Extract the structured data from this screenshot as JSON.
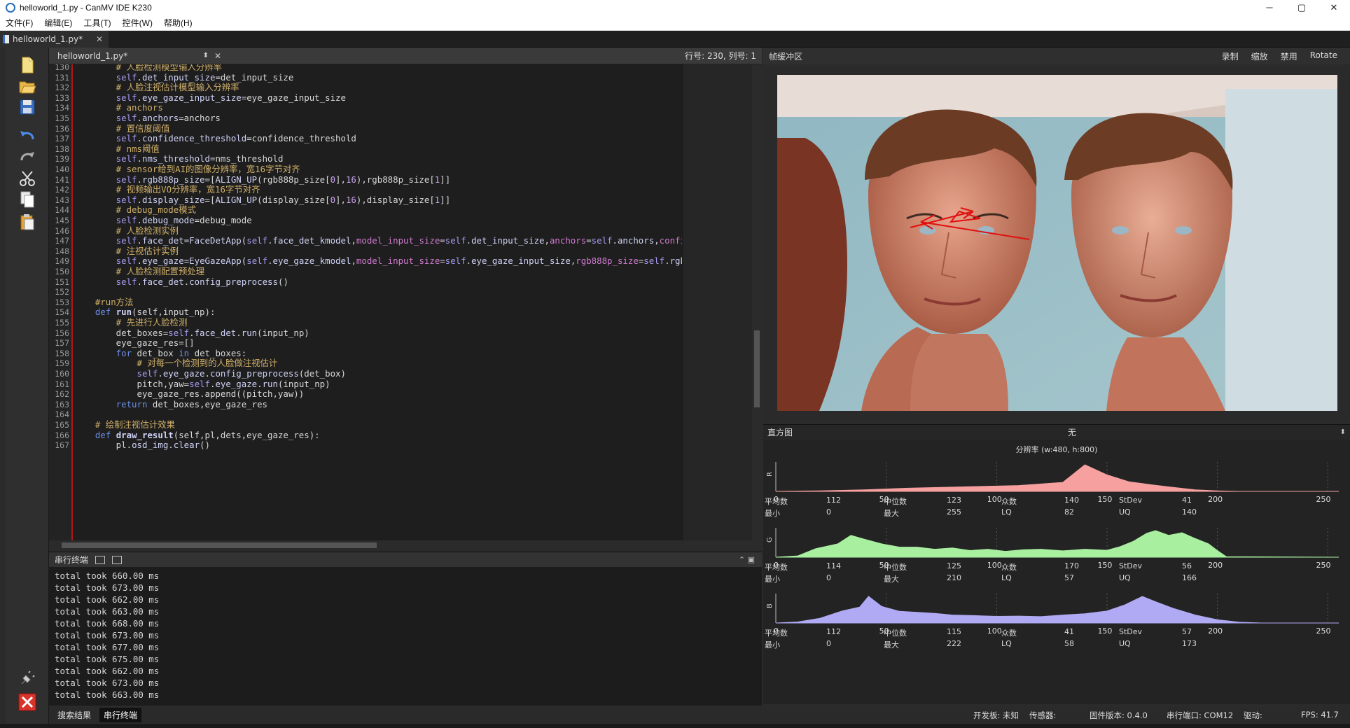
{
  "window": {
    "title": "helloworld_1.py - CanMV IDE K230",
    "minimize": "─",
    "maximize": "▢",
    "close": "✕"
  },
  "menu": [
    "文件(F)",
    "编辑(E)",
    "工具(T)",
    "控件(W)",
    "帮助(H)"
  ],
  "tab": {
    "label": "helloworld_1.py*"
  },
  "editor": {
    "file": "helloworld_1.py*",
    "position": "行号: 230, 列号: 1",
    "lines": [
      {
        "n": "130",
        "t": [
          [
            "c",
            "        # 人脸检测模型输入分辨率"
          ]
        ]
      },
      {
        "n": "131",
        "t": [
          [
            "s",
            "        self"
          ],
          [
            "w",
            "."
          ],
          [
            "a",
            "det_input_size"
          ],
          [
            "w",
            "=det_input_size"
          ]
        ]
      },
      {
        "n": "132",
        "t": [
          [
            "c",
            "        # 人脸注视估计模型输入分辨率"
          ]
        ]
      },
      {
        "n": "133",
        "t": [
          [
            "s",
            "        self"
          ],
          [
            "w",
            "."
          ],
          [
            "a",
            "eye_gaze_input_size"
          ],
          [
            "w",
            "=eye_gaze_input_size"
          ]
        ]
      },
      {
        "n": "134",
        "t": [
          [
            "c",
            "        # anchors"
          ]
        ]
      },
      {
        "n": "135",
        "t": [
          [
            "s",
            "        self"
          ],
          [
            "w",
            "."
          ],
          [
            "a",
            "anchors"
          ],
          [
            "w",
            "=anchors"
          ]
        ]
      },
      {
        "n": "136",
        "t": [
          [
            "c",
            "        # 置信度阈值"
          ]
        ]
      },
      {
        "n": "137",
        "t": [
          [
            "s",
            "        self"
          ],
          [
            "w",
            "."
          ],
          [
            "a",
            "confidence_threshold"
          ],
          [
            "w",
            "=confidence_threshold"
          ]
        ]
      },
      {
        "n": "138",
        "t": [
          [
            "c",
            "        # nms阈值"
          ]
        ]
      },
      {
        "n": "139",
        "t": [
          [
            "s",
            "        self"
          ],
          [
            "w",
            "."
          ],
          [
            "a",
            "nms_threshold"
          ],
          [
            "w",
            "=nms_threshold"
          ]
        ]
      },
      {
        "n": "140",
        "t": [
          [
            "c",
            "        # sensor给到AI的图像分辨率，宽16字节对齐"
          ]
        ]
      },
      {
        "n": "141",
        "t": [
          [
            "s",
            "        self"
          ],
          [
            "w",
            "."
          ],
          [
            "a",
            "rgb888p_size"
          ],
          [
            "w",
            "=["
          ],
          [
            "a",
            "ALIGN_UP"
          ],
          [
            "w",
            "(rgb888p_size["
          ],
          [
            "n",
            "0"
          ],
          [
            "w",
            "],"
          ],
          [
            "n",
            "16"
          ],
          [
            "w",
            "),rgb888p_size["
          ],
          [
            "n",
            "1"
          ],
          [
            "w",
            "]]"
          ]
        ]
      },
      {
        "n": "142",
        "t": [
          [
            "c",
            "        # 视频输出VO分辨率，宽16字节对齐"
          ]
        ]
      },
      {
        "n": "143",
        "t": [
          [
            "s",
            "        self"
          ],
          [
            "w",
            "."
          ],
          [
            "a",
            "display_size"
          ],
          [
            "w",
            "=["
          ],
          [
            "a",
            "ALIGN_UP"
          ],
          [
            "w",
            "(display_size["
          ],
          [
            "n",
            "0"
          ],
          [
            "w",
            "],"
          ],
          [
            "n",
            "16"
          ],
          [
            "w",
            "),display_size["
          ],
          [
            "n",
            "1"
          ],
          [
            "w",
            "]]"
          ]
        ]
      },
      {
        "n": "144",
        "t": [
          [
            "c",
            "        # debug_mode模式"
          ]
        ]
      },
      {
        "n": "145",
        "t": [
          [
            "s",
            "        self"
          ],
          [
            "w",
            "."
          ],
          [
            "a",
            "debug_mode"
          ],
          [
            "w",
            "=debug_mode"
          ]
        ]
      },
      {
        "n": "146",
        "t": [
          [
            "c",
            "        # 人脸检测实例"
          ]
        ]
      },
      {
        "n": "147",
        "t": [
          [
            "s",
            "        self"
          ],
          [
            "w",
            "."
          ],
          [
            "a",
            "face_det"
          ],
          [
            "w",
            "="
          ],
          [
            "a",
            "FaceDetApp"
          ],
          [
            "w",
            "("
          ],
          [
            "s",
            "self"
          ],
          [
            "w",
            "."
          ],
          [
            "a",
            "face_det_kmodel"
          ],
          [
            "w",
            ","
          ],
          [
            "p",
            "model_input_size"
          ],
          [
            "w",
            "="
          ],
          [
            "s",
            "self"
          ],
          [
            "w",
            "."
          ],
          [
            "a",
            "det_input_size"
          ],
          [
            "w",
            ","
          ],
          [
            "p",
            "anchors"
          ],
          [
            "w",
            "="
          ],
          [
            "s",
            "self"
          ],
          [
            "w",
            "."
          ],
          [
            "a",
            "anchors"
          ],
          [
            "w",
            ","
          ],
          [
            "p",
            "confidenc"
          ]
        ]
      },
      {
        "n": "148",
        "t": [
          [
            "c",
            "        # 注视估计实例"
          ]
        ]
      },
      {
        "n": "149",
        "t": [
          [
            "s",
            "        self"
          ],
          [
            "w",
            "."
          ],
          [
            "a",
            "eye_gaze"
          ],
          [
            "w",
            "="
          ],
          [
            "a",
            "EyeGazeApp"
          ],
          [
            "w",
            "("
          ],
          [
            "s",
            "self"
          ],
          [
            "w",
            "."
          ],
          [
            "a",
            "eye_gaze_kmodel"
          ],
          [
            "w",
            ","
          ],
          [
            "p",
            "model_input_size"
          ],
          [
            "w",
            "="
          ],
          [
            "s",
            "self"
          ],
          [
            "w",
            "."
          ],
          [
            "a",
            "eye_gaze_input_size"
          ],
          [
            "w",
            ","
          ],
          [
            "p",
            "rgb888p_size"
          ],
          [
            "w",
            "="
          ],
          [
            "s",
            "self"
          ],
          [
            "w",
            "."
          ],
          [
            "a",
            "rgb888p"
          ]
        ]
      },
      {
        "n": "150",
        "t": [
          [
            "c",
            "        # 人脸检测配置预处理"
          ]
        ]
      },
      {
        "n": "151",
        "t": [
          [
            "s",
            "        self"
          ],
          [
            "w",
            "."
          ],
          [
            "a",
            "face_det"
          ],
          [
            "w",
            "."
          ],
          [
            "a",
            "config_preprocess"
          ],
          [
            "w",
            "()"
          ]
        ]
      },
      {
        "n": "152",
        "t": [
          [
            "w",
            ""
          ]
        ]
      },
      {
        "n": "153",
        "t": [
          [
            "c",
            "    #run方法"
          ]
        ]
      },
      {
        "n": "154",
        "t": [
          [
            "k",
            "    def "
          ],
          [
            "f",
            "run"
          ],
          [
            "w",
            "(self,input_np):"
          ]
        ]
      },
      {
        "n": "155",
        "t": [
          [
            "c",
            "        # 先进行人脸检测"
          ]
        ]
      },
      {
        "n": "156",
        "t": [
          [
            "w",
            "        det_boxes="
          ],
          [
            "s",
            "self"
          ],
          [
            "w",
            "."
          ],
          [
            "a",
            "face_det"
          ],
          [
            "w",
            "."
          ],
          [
            "a",
            "run"
          ],
          [
            "w",
            "(input_np)"
          ]
        ]
      },
      {
        "n": "157",
        "t": [
          [
            "w",
            "        eye_gaze_res=[]"
          ]
        ]
      },
      {
        "n": "158",
        "t": [
          [
            "k",
            "        for "
          ],
          [
            "w",
            "det_box "
          ],
          [
            "k",
            "in "
          ],
          [
            "w",
            "det_boxes:"
          ]
        ]
      },
      {
        "n": "159",
        "t": [
          [
            "c",
            "            # 对每一个检测到的人脸做注视估计"
          ]
        ]
      },
      {
        "n": "160",
        "t": [
          [
            "s",
            "            self"
          ],
          [
            "w",
            "."
          ],
          [
            "a",
            "eye_gaze"
          ],
          [
            "w",
            "."
          ],
          [
            "a",
            "config_preprocess"
          ],
          [
            "w",
            "(det_box)"
          ]
        ]
      },
      {
        "n": "161",
        "t": [
          [
            "w",
            "            pitch,yaw="
          ],
          [
            "s",
            "self"
          ],
          [
            "w",
            "."
          ],
          [
            "a",
            "eye_gaze"
          ],
          [
            "w",
            "."
          ],
          [
            "a",
            "run"
          ],
          [
            "w",
            "(input_np)"
          ]
        ]
      },
      {
        "n": "162",
        "t": [
          [
            "w",
            "            eye_gaze_res.append((pitch,yaw))"
          ]
        ]
      },
      {
        "n": "163",
        "t": [
          [
            "k",
            "        return "
          ],
          [
            "w",
            "det_boxes,eye_gaze_res"
          ]
        ]
      },
      {
        "n": "164",
        "t": [
          [
            "w",
            ""
          ]
        ]
      },
      {
        "n": "165",
        "t": [
          [
            "c",
            "    # 绘制注视估计效果"
          ]
        ]
      },
      {
        "n": "166",
        "t": [
          [
            "k",
            "    def "
          ],
          [
            "f",
            "draw_result"
          ],
          [
            "w",
            "(self,pl,dets,eye_gaze_res):"
          ]
        ]
      },
      {
        "n": "167",
        "t": [
          [
            "w",
            "        pl."
          ],
          [
            "a",
            "osd_img"
          ],
          [
            "w",
            "."
          ],
          [
            "a",
            "clear"
          ],
          [
            "w",
            "()"
          ]
        ]
      }
    ]
  },
  "terminal": {
    "title": "串行终端",
    "lines": [
      "total took 660.00 ms",
      "total took 673.00 ms",
      "total took 662.00 ms",
      "total took 663.00 ms",
      "total took 668.00 ms",
      "total took 673.00 ms",
      "total took 677.00 ms",
      "total took 675.00 ms",
      "total took 662.00 ms",
      "total took 673.00 ms",
      "total took 663.00 ms"
    ]
  },
  "bottom_tabs": [
    "搜索结果",
    "串行终端"
  ],
  "framebuffer": {
    "title": "帧缓冲区",
    "actions": [
      "录制",
      "缩放",
      "禁用",
      "Rotate"
    ]
  },
  "histogram": {
    "title": "直方图",
    "mode": "无",
    "resolution": "分辨率 (w:480, h:800)",
    "ticks": [
      "0",
      "50",
      "100",
      "150",
      "200",
      "250"
    ],
    "channels": [
      {
        "name": "R",
        "color": "#f6a0a0",
        "stats": [
          [
            "平均数",
            "112"
          ],
          [
            "中位数",
            "123"
          ],
          [
            "众数",
            "140"
          ],
          [
            "StDev",
            "41"
          ],
          [
            "最小",
            "0"
          ],
          [
            "最大",
            "255"
          ],
          [
            "LQ",
            "82"
          ],
          [
            "UQ",
            "140"
          ]
        ]
      },
      {
        "name": "G",
        "color": "#a8f0a0",
        "stats": [
          [
            "平均数",
            "114"
          ],
          [
            "中位数",
            "125"
          ],
          [
            "众数",
            "170"
          ],
          [
            "StDev",
            "56"
          ],
          [
            "最小",
            "0"
          ],
          [
            "最大",
            "210"
          ],
          [
            "LQ",
            "57"
          ],
          [
            "UQ",
            "166"
          ]
        ]
      },
      {
        "name": "B",
        "color": "#b0aaf4",
        "stats": [
          [
            "平均数",
            "112"
          ],
          [
            "中位数",
            "115"
          ],
          [
            "众数",
            "41"
          ],
          [
            "StDev",
            "57"
          ],
          [
            "最小",
            "0"
          ],
          [
            "最大",
            "222"
          ],
          [
            "LQ",
            "58"
          ],
          [
            "UQ",
            "173"
          ]
        ]
      }
    ]
  },
  "status": {
    "board": "开发板: 未知",
    "sensor": "传感器:",
    "firmware": "固件版本: 0.4.0",
    "port": "串行端口: COM12",
    "driver": "驱动:",
    "fps": "FPS:   41.7"
  },
  "colors": {
    "comment": "#d0b06a",
    "self": "#a59cf2",
    "attr": "#cfd2f6",
    "param": "#d07ad0",
    "keyword": "#6b8ee6",
    "number": "#c9a4f0",
    "text": "#d8d8d8"
  }
}
